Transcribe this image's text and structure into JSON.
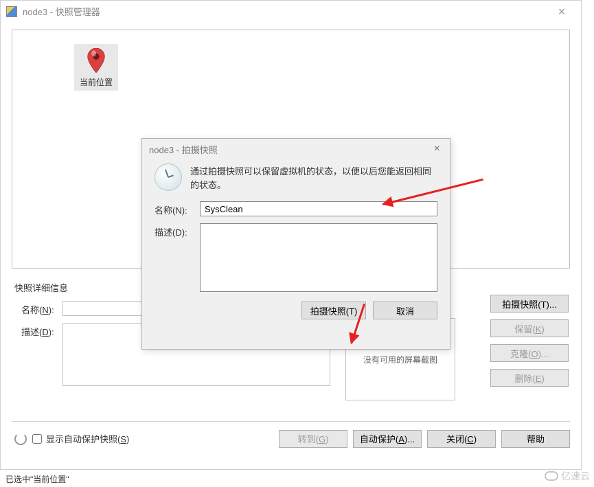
{
  "main_window": {
    "title": "node3 - 快照管理器",
    "current_node_label": "当前位置"
  },
  "details": {
    "section_title": "快照详细信息",
    "name_label": "名称(",
    "name_key": "N",
    "name_label_end": "):",
    "name_value": "",
    "desc_label": "描述(",
    "desc_key": "D",
    "desc_label_end": "):",
    "desc_value": "",
    "preview_text": "没有可用的屏幕截图"
  },
  "right_buttons": {
    "take": "拍摄快照(T)...",
    "keep": "保留(K)",
    "keep_key": "K",
    "clone": "克隆(O)...",
    "clone_key": "O",
    "delete": "删除(E)",
    "delete_key": "E"
  },
  "bottom": {
    "checkbox_label": "显示自动保护快照(",
    "checkbox_key": "S",
    "checkbox_end": ")",
    "goto": "转到(",
    "goto_key": "G",
    "goto_end": ")",
    "autoprotect": "自动保护(",
    "autoprotect_key": "A",
    "autoprotect_end": ")...",
    "close": "关闭(",
    "close_key": "C",
    "close_end": ")",
    "help": "帮助"
  },
  "status_bar": "已选中\"当前位置\"",
  "modal": {
    "title": "node3 - 拍摄快照",
    "info_text": "通过拍摄快照可以保留虚拟机的状态，以便以后您能返回相同的状态。",
    "name_label": "名称(N):",
    "name_value": "SysClean",
    "desc_label": "描述(D):",
    "desc_value": "",
    "take_button": "拍摄快照(T)",
    "cancel_button": "取消"
  },
  "watermark": "亿速云"
}
